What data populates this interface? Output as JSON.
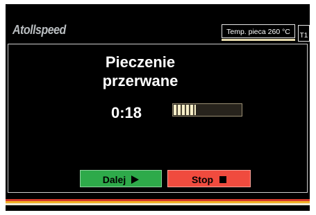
{
  "brand": {
    "logo_text": "Atollspeed"
  },
  "header": {
    "temperature_label": "Temp. pieca 260 °C",
    "tag": "T1"
  },
  "main": {
    "title": "Pieczenie przerwane",
    "timer": "0:18",
    "progress_fraction": 0.33
  },
  "buttons": {
    "continue_label": "Dalej",
    "continue_icon": "play-icon",
    "stop_label": "Stop",
    "stop_icon": "stop-icon"
  },
  "colors": {
    "background": "#000000",
    "continue_button": "#2eaa4a",
    "stop_button": "#f04b3e",
    "progress_fill": "#f6eec8",
    "stripes": [
      "#d53a2a",
      "#f2b127",
      "#ece8d6"
    ]
  }
}
